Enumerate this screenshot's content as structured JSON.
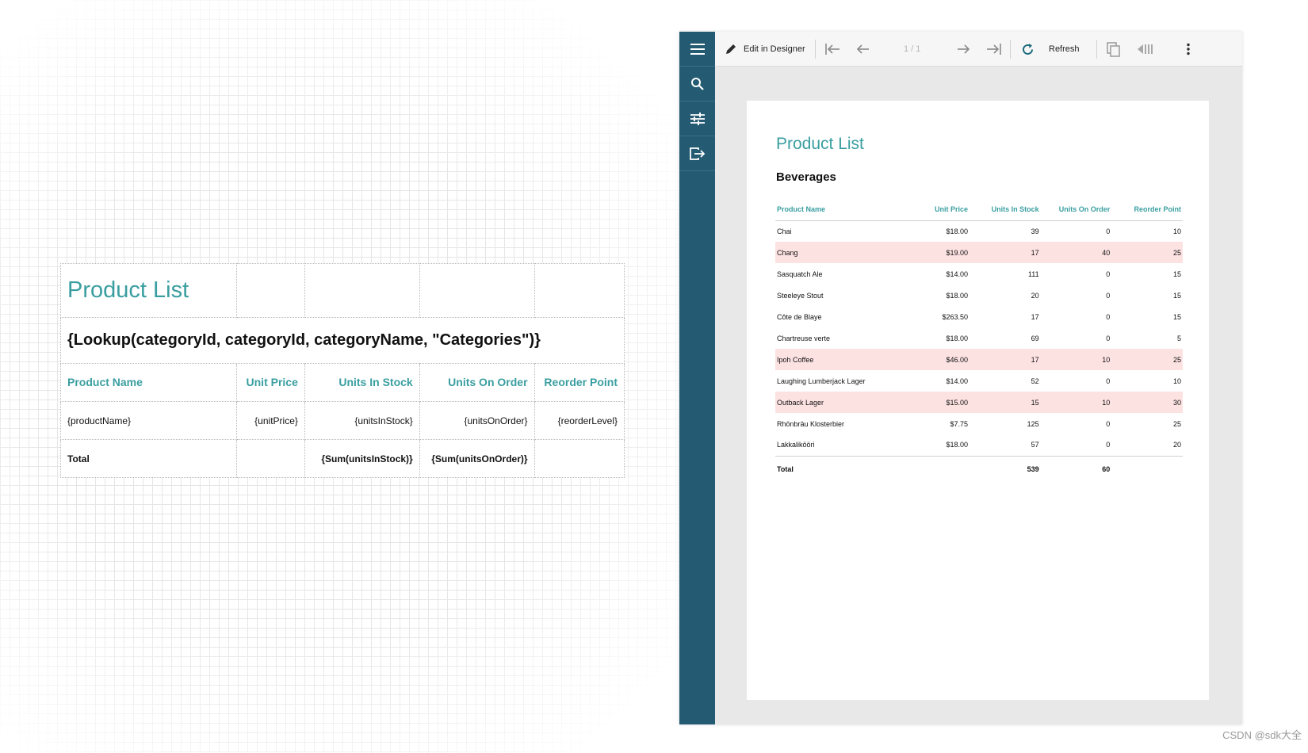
{
  "designer": {
    "title": "Product List",
    "category_expr": "{Lookup(categoryId, categoryId, categoryName, \"Categories\")}",
    "headers": [
      "Product Name",
      "Unit Price",
      "Units In Stock",
      "Units On Order",
      "Reorder Point"
    ],
    "detail": [
      "{productName}",
      "{unitPrice}",
      "{unitsInStock}",
      "{unitsOnOrder}",
      "{reorderLevel}"
    ],
    "total_label": "Total",
    "total_stock": "{Sum(unitsInStock)}",
    "total_order": "{Sum(unitsOnOrder)}"
  },
  "toolbar": {
    "edit_label": "Edit in Designer",
    "page_indicator": "1 / 1",
    "refresh_label": "Refresh"
  },
  "report": {
    "title": "Product List",
    "category": "Beverages",
    "headers": [
      "Product Name",
      "Unit Price",
      "Units In Stock",
      "Units On Order",
      "Reorder Point"
    ],
    "rows": [
      {
        "name": "Chai",
        "price": "$18.00",
        "stock": "39",
        "order": "0",
        "reorder": "10",
        "highlight": false
      },
      {
        "name": "Chang",
        "price": "$19.00",
        "stock": "17",
        "order": "40",
        "reorder": "25",
        "highlight": true
      },
      {
        "name": "Sasquatch Ale",
        "price": "$14.00",
        "stock": "111",
        "order": "0",
        "reorder": "15",
        "highlight": false
      },
      {
        "name": "Steeleye Stout",
        "price": "$18.00",
        "stock": "20",
        "order": "0",
        "reorder": "15",
        "highlight": false
      },
      {
        "name": "Côte de Blaye",
        "price": "$263.50",
        "stock": "17",
        "order": "0",
        "reorder": "15",
        "highlight": false
      },
      {
        "name": "Chartreuse verte",
        "price": "$18.00",
        "stock": "69",
        "order": "0",
        "reorder": "5",
        "highlight": false
      },
      {
        "name": "Ipoh Coffee",
        "price": "$46.00",
        "stock": "17",
        "order": "10",
        "reorder": "25",
        "highlight": true
      },
      {
        "name": "Laughing Lumberjack Lager",
        "price": "$14.00",
        "stock": "52",
        "order": "0",
        "reorder": "10",
        "highlight": false
      },
      {
        "name": "Outback Lager",
        "price": "$15.00",
        "stock": "15",
        "order": "10",
        "reorder": "30",
        "highlight": true
      },
      {
        "name": "Rhönbräu Klosterbier",
        "price": "$7.75",
        "stock": "125",
        "order": "0",
        "reorder": "25",
        "highlight": false
      },
      {
        "name": "Lakkalikööri",
        "price": "$18.00",
        "stock": "57",
        "order": "0",
        "reorder": "20",
        "highlight": false
      }
    ],
    "total_label": "Total",
    "total_stock": "539",
    "total_order": "60"
  },
  "icons": {
    "menu": "menu-icon",
    "search": "search-icon",
    "parameters": "sliders-icon",
    "export": "export-icon",
    "edit": "pencil-icon",
    "first": "first-page-icon",
    "prev": "previous-page-icon",
    "next": "next-page-icon",
    "last": "last-page-icon",
    "refresh": "refresh-icon",
    "galley": "galley-mode-icon",
    "sidebar_toggle": "toggle-sidebar-icon",
    "more": "more-vertical-icon"
  },
  "colors": {
    "accent": "#3a9ea0",
    "sidebar": "#245b73",
    "highlight_row": "#fde2e2"
  },
  "watermark": "CSDN @sdk大全"
}
